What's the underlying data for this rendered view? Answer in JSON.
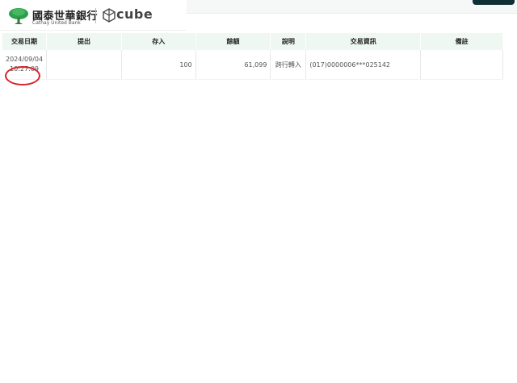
{
  "brand": {
    "bank_name": "國泰世華銀行",
    "bank_name_en": "Cathay United Bank",
    "product": "cube",
    "tree_color": "#2e9e4a"
  },
  "table": {
    "headers": [
      "交易日期",
      "提出",
      "存入",
      "餘額",
      "說明",
      "交易資訊",
      "備註"
    ],
    "rows": [
      {
        "date": "2024/09/04",
        "time": "10:27:09",
        "withdraw": "",
        "deposit": "100",
        "balance": "61,099",
        "description": "跨行轉入",
        "info": "(017)0000006***025142",
        "note": ""
      }
    ]
  },
  "annotation": {
    "highlight": "time",
    "color": "#d8212b"
  }
}
